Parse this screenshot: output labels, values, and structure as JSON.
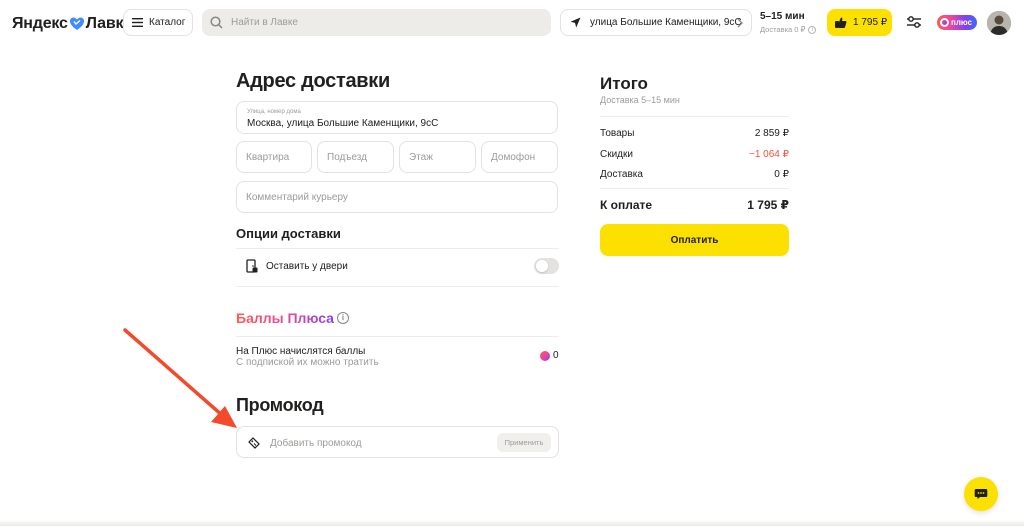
{
  "header": {
    "logo_part1": "Яндекс",
    "logo_part2": "Лавка",
    "catalog_label": "Каталог",
    "search_placeholder": "Найти в Лавке",
    "address": "улица Большие Каменщики, 9сС",
    "eta": "5–15 мин",
    "delivery_fee": "Доставка 0 ₽",
    "cart_total": "1 795 ₽",
    "plus_label": "плюс"
  },
  "delivery": {
    "title": "Адрес доставки",
    "street_label": "Улица, номер дома",
    "street_value": "Москва, улица Большие Каменщики, 9сС",
    "apartment_placeholder": "Квартира",
    "entrance_placeholder": "Подъезд",
    "floor_placeholder": "Этаж",
    "intercom_placeholder": "Домофон",
    "comment_placeholder": "Комментарий курьеру"
  },
  "options": {
    "title": "Опции доставки",
    "leave_at_door": "Оставить у двери",
    "leave_at_door_enabled": false
  },
  "plus_points": {
    "title": "Баллы Плюса",
    "info_symbol": "i",
    "line1": "На Плюс начислятся баллы",
    "line2": "С подпиской их можно тратить",
    "amount": "0"
  },
  "promo": {
    "title": "Промокод",
    "placeholder": "Добавить промокод",
    "apply_label": "Применить"
  },
  "summary": {
    "title": "Итого",
    "subtitle": "Доставка 5–15 мин",
    "rows": [
      {
        "label": "Товары",
        "value": "2 859 ₽"
      },
      {
        "label": "Скидки",
        "value": "−1 064 ₽"
      },
      {
        "label": "Доставка",
        "value": "0 ₽"
      }
    ],
    "total_label": "К оплате",
    "total_value": "1 795 ₽",
    "pay_label": "Оплатить"
  },
  "colors": {
    "accent_yellow": "#fce000",
    "discount_red": "#f5523a",
    "annotation_arrow": "#f24a2a",
    "muted_text": "#9e9b98"
  }
}
